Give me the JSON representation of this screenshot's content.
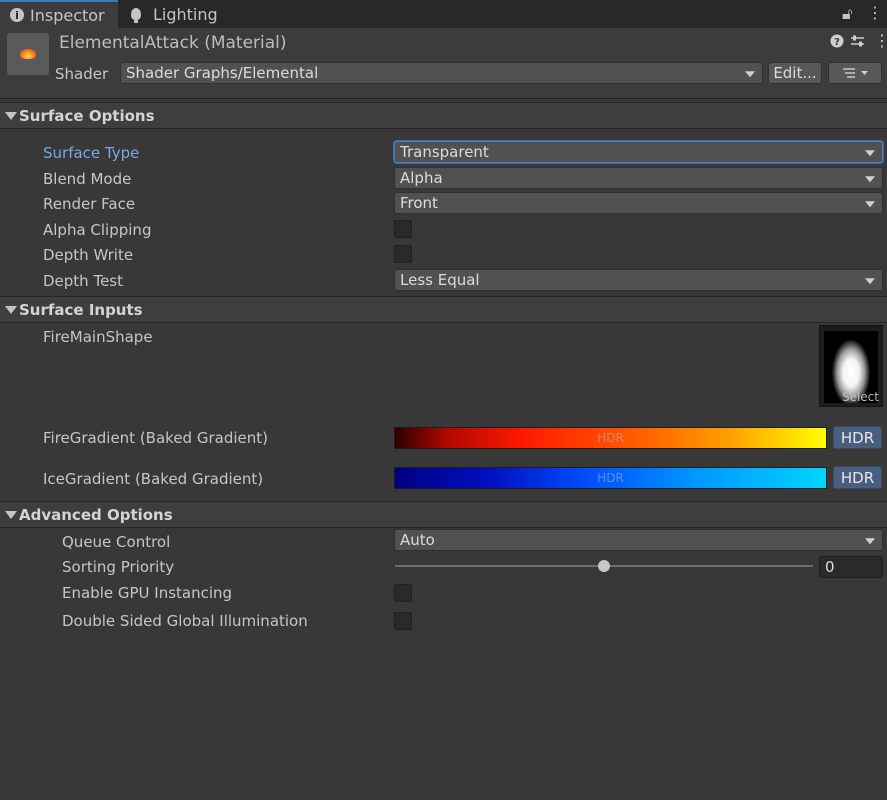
{
  "tabs": [
    {
      "label": "Inspector",
      "icon": "info-icon"
    },
    {
      "label": "Lighting",
      "icon": "lightbulb-icon"
    }
  ],
  "header": {
    "title": "ElementalAttack (Material)",
    "shader_label": "Shader",
    "shader_value": "Shader Graphs/Elemental",
    "edit_label": "Edit..."
  },
  "surface_options": {
    "title": "Surface Options",
    "surface_type": {
      "label": "Surface Type",
      "value": "Transparent"
    },
    "blend_mode": {
      "label": "Blend Mode",
      "value": "Alpha"
    },
    "render_face": {
      "label": "Render Face",
      "value": "Front"
    },
    "alpha_clipping": {
      "label": "Alpha Clipping",
      "checked": false
    },
    "depth_write": {
      "label": "Depth Write",
      "checked": false
    },
    "depth_test": {
      "label": "Depth Test",
      "value": "Less Equal"
    }
  },
  "surface_inputs": {
    "title": "Surface Inputs",
    "fire_main_shape": {
      "label": "FireMainShape",
      "select_label": "Select"
    },
    "fire_gradient": {
      "label": "FireGradient (Baked Gradient)",
      "overlay": "HDR",
      "button": "HDR"
    },
    "ice_gradient": {
      "label": "IceGradient (Baked Gradient)",
      "overlay": "HDR",
      "button": "HDR"
    }
  },
  "advanced_options": {
    "title": "Advanced Options",
    "queue_control": {
      "label": "Queue Control",
      "value": "Auto"
    },
    "sorting_priority": {
      "label": "Sorting Priority",
      "value": "0",
      "slider_fraction": 0.5
    },
    "gpu_instancing": {
      "label": "Enable GPU Instancing",
      "checked": false
    },
    "double_sided_gi": {
      "label": "Double Sided Global Illumination",
      "checked": false
    }
  },
  "colors": {
    "accent_blue": "#4d7fc4",
    "fire_gradient": [
      "#2a0000",
      "#ff1a00",
      "#ff9a00",
      "#ffff00"
    ],
    "ice_gradient": [
      "#000080",
      "#0050ff",
      "#00d4ff"
    ]
  }
}
